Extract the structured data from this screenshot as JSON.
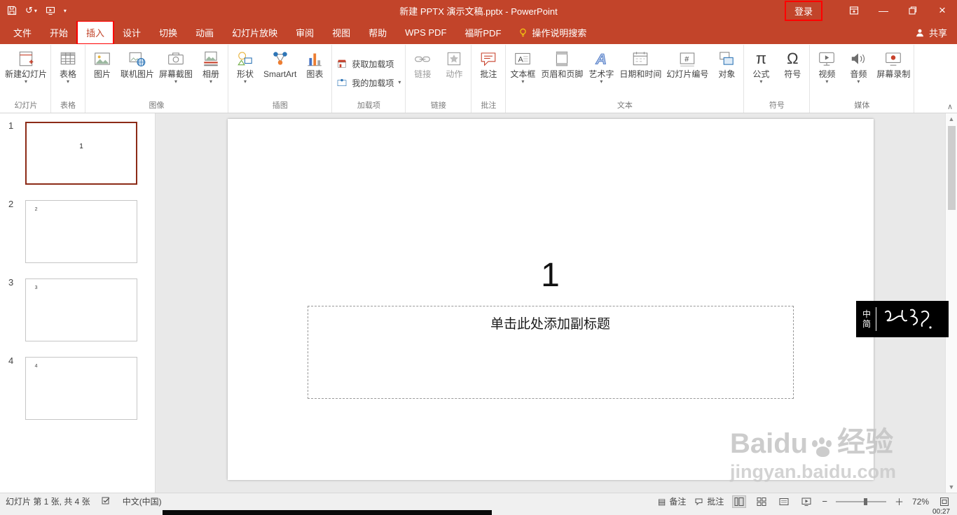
{
  "titlebar": {
    "title": "新建 PPTX 演示文稿.pptx - PowerPoint",
    "login": "登录"
  },
  "tabs": {
    "items": [
      "文件",
      "开始",
      "插入",
      "设计",
      "切换",
      "动画",
      "幻灯片放映",
      "审阅",
      "视图",
      "帮助",
      "WPS PDF",
      "福昕PDF"
    ],
    "active": "插入",
    "tellme": "操作说明搜索",
    "share": "共享"
  },
  "ribbon": {
    "groups": [
      {
        "label": "幻灯片",
        "buttons": [
          {
            "label": "新建幻灯片"
          }
        ]
      },
      {
        "label": "表格",
        "buttons": [
          {
            "label": "表格"
          }
        ]
      },
      {
        "label": "图像",
        "buttons": [
          {
            "label": "图片"
          },
          {
            "label": "联机图片"
          },
          {
            "label": "屏幕截图"
          },
          {
            "label": "相册"
          }
        ]
      },
      {
        "label": "插图",
        "buttons": [
          {
            "label": "形状"
          },
          {
            "label": "SmartArt"
          },
          {
            "label": "图表"
          }
        ]
      },
      {
        "label": "加载项",
        "buttons": [
          {
            "label": "获取加载项"
          },
          {
            "label": "我的加载项"
          }
        ]
      },
      {
        "label": "链接",
        "buttons": [
          {
            "label": "链接"
          },
          {
            "label": "动作"
          }
        ]
      },
      {
        "label": "批注",
        "buttons": [
          {
            "label": "批注"
          }
        ]
      },
      {
        "label": "文本",
        "buttons": [
          {
            "label": "文本框"
          },
          {
            "label": "页眉和页脚"
          },
          {
            "label": "艺术字"
          },
          {
            "label": "日期和时间"
          },
          {
            "label": "幻灯片编号"
          },
          {
            "label": "对象"
          }
        ]
      },
      {
        "label": "符号",
        "buttons": [
          {
            "label": "公式"
          },
          {
            "label": "符号"
          }
        ]
      },
      {
        "label": "媒体",
        "buttons": [
          {
            "label": "视频"
          },
          {
            "label": "音频"
          },
          {
            "label": "屏幕录制"
          }
        ]
      }
    ]
  },
  "thumbnails": {
    "items": [
      {
        "n": "1",
        "content": "1"
      },
      {
        "n": "2",
        "content": "2"
      },
      {
        "n": "3",
        "content": "3"
      },
      {
        "n": "4",
        "content": "4"
      }
    ]
  },
  "slide": {
    "title": "1",
    "subtitle": "单击此处添加副标题"
  },
  "badge": {
    "top": "中",
    "bottom": "简"
  },
  "watermark": {
    "brand": "Baidu",
    "cn": "经验",
    "url": "jingyan.baidu.com"
  },
  "statusbar": {
    "slide_info": "幻灯片 第 1 张, 共 4 张",
    "language": "中文(中国)",
    "notes": "备注",
    "comments": "批注",
    "zoom": "72%"
  },
  "video": {
    "time": "00:27"
  },
  "colors": {
    "accent": "#C2442A",
    "annotation": "#FF0000",
    "selection_border": "#8C2B17"
  },
  "icons": {
    "chevron_down": "▾",
    "undo": "↺",
    "minimize": "—",
    "close": "×",
    "scroll_up": "▲",
    "scroll_down": "▼",
    "ribbon_collapse": "∧",
    "zoom_out": "−",
    "zoom_in": "＋",
    "spell_check": "✓",
    "pi": "π",
    "omega": "Ω",
    "letter_a": "A",
    "hash": "#",
    "notes_lines": "▤"
  }
}
